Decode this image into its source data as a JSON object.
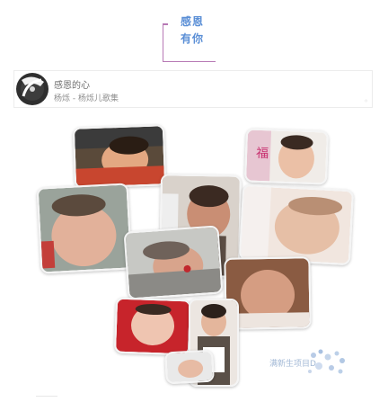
{
  "header": {
    "title_line1": "感恩",
    "title_line2": "有你"
  },
  "music_player": {
    "song_title": "感恩的心",
    "artist_album": "杨烁 - 杨烁儿歌集"
  },
  "watermark": {
    "text": "满新生项目D"
  },
  "colors": {
    "accent_purple": "#b779b5",
    "title_blue": "#5b8fd6"
  },
  "icons": [
    "vinyl-disc-icon",
    "more-dot-icon",
    "watermark-flower-icon"
  ]
}
